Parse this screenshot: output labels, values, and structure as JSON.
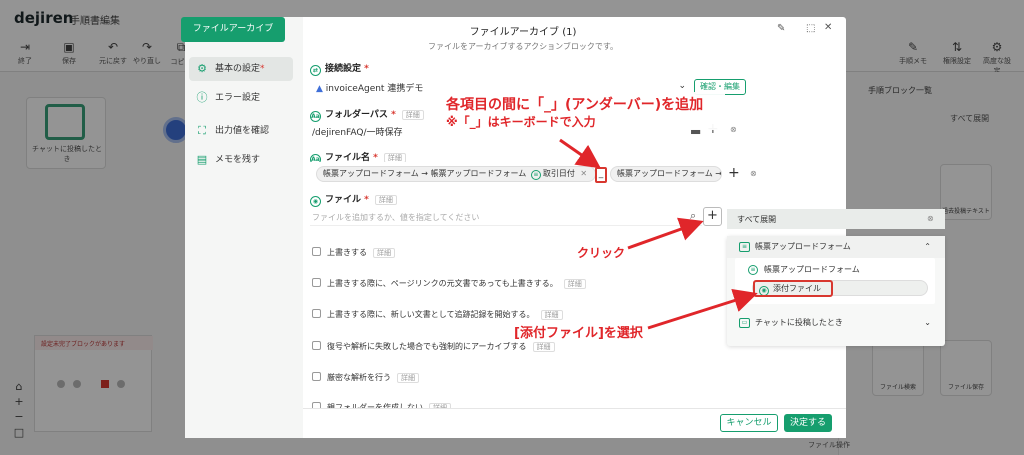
{
  "app": {
    "logo": "dejiren",
    "title": "手順書編集"
  },
  "toolbar": {
    "items": [
      "終了",
      "保存",
      "元に戻す",
      "やり直し",
      "コピー"
    ],
    "right_items": [
      "手順メモ",
      "権限設定",
      "高度な設定"
    ]
  },
  "canvas": {
    "flow_card_label": "チャットに投稿したとき",
    "minimap_warning": "設定未完了ブロックがあります",
    "zoom_controls": [
      "⌂",
      "+",
      "−",
      "□"
    ]
  },
  "right_panel": {
    "title": "手順ブロック一覧",
    "filter": "すべて展開",
    "tiles": [
      "過去投稿テキスト",
      "ファイル検索",
      "ファイル保存",
      "ファイル操作"
    ]
  },
  "modal": {
    "tab_label": "ファイルアーカイブ",
    "title": "ファイルアーカイブ (1)",
    "subtitle": "ファイルをアーカイブするアクションブロックです。",
    "side_menu": [
      {
        "label": "基本の設定",
        "required": "*"
      },
      {
        "label": "エラー設定"
      },
      {
        "label": "出力値を確認"
      },
      {
        "label": "メモを残す"
      }
    ],
    "connection": {
      "label": "接続設定",
      "required": "*",
      "value": "invoiceAgent 連携デモ",
      "button": "確認・編集"
    },
    "folder": {
      "label": "フォルダーパス",
      "required": "*",
      "detail": "詳細",
      "value": "/dejirenFAQ/一時保存"
    },
    "filename": {
      "label": "ファイル名",
      "required": "*",
      "detail": "詳細",
      "chip1_text": "帳票アップロードフォーム → 帳票アップロードフォーム",
      "chip1_field": "取引日付",
      "separator": "_",
      "chip2_text": "帳票アップロードフォーム →"
    },
    "file": {
      "label": "ファイル",
      "required": "*",
      "detail": "詳細",
      "placeholder": "ファイルを追加するか、値を指定してください"
    },
    "checkboxes": [
      {
        "label": "上書きする",
        "detail": "詳細"
      },
      {
        "label": "上書きする際に、ページリンクの元文書であっても上書きする。",
        "detail": "詳細"
      },
      {
        "label": "上書きする際に、新しい文書として追跡記録を開始する。",
        "detail": "詳細"
      },
      {
        "label": "復号や解析に失敗した場合でも強制的にアーカイブする",
        "detail": "詳細"
      },
      {
        "label": "厳密な解析を行う",
        "detail": "詳細"
      },
      {
        "label": "親フォルダーを作成しない",
        "detail": "詳細"
      }
    ],
    "cancel": "キャンセル",
    "ok": "決定する"
  },
  "dropdown": {
    "expand_all": "すべて展開",
    "group1": "帳票アップロードフォーム",
    "group1_item": "帳票アップロードフォーム",
    "selected_item": "添付ファイル",
    "group2": "チャットに投稿したとき"
  },
  "annotations": {
    "line1": "各項目の間に「_」(アンダーバー)を追加",
    "line2": "※「_」はキーボードで入力",
    "click": "クリック",
    "select": "[添付ファイル]を選択"
  },
  "colors": {
    "accent": "#169e6e",
    "annotation": "#e0262a"
  }
}
